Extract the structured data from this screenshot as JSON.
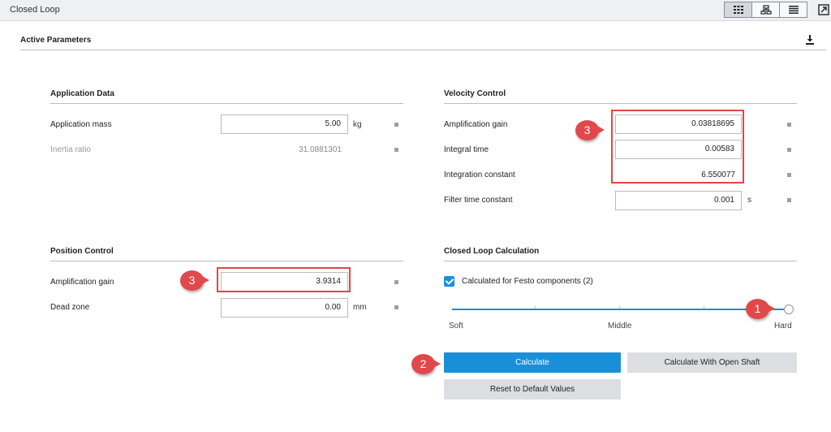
{
  "window": {
    "title": "Closed Loop"
  },
  "header": {
    "title": "Active Parameters"
  },
  "application_data": {
    "title": "Application Data",
    "mass_label": "Application mass",
    "mass_value": "5.00",
    "mass_unit": "kg",
    "inertia_label": "Inertia ratio",
    "inertia_value": "31.0881301"
  },
  "velocity_control": {
    "title": "Velocity Control",
    "amp_gain_label": "Amplification gain",
    "amp_gain_value": "0.03818695",
    "integral_time_label": "Integral time",
    "integral_time_value": "0.00583",
    "integration_constant_label": "Integration constant",
    "integration_constant_value": "6.550077",
    "filter_label": "Filter time constant",
    "filter_value": "0.001",
    "filter_unit": "s"
  },
  "position_control": {
    "title": "Position Control",
    "amp_gain_label": "Amplification gain",
    "amp_gain_value": "3.9314",
    "dead_zone_label": "Dead zone",
    "dead_zone_value": "0.00",
    "dead_zone_unit": "mm"
  },
  "closed_loop_calc": {
    "title": "Closed Loop Calculation",
    "checkbox_label": "Calculated for Festo components (2)",
    "checked": true,
    "slider": {
      "labels": [
        "Soft",
        "Middle",
        "Hard"
      ],
      "selected": "Hard",
      "level": 1.0
    },
    "calculate_label": "Calculate",
    "open_shaft_label": "Calculate With Open Shaft",
    "reset_label": "Reset to Default Values"
  },
  "annotations": {
    "badge_1": "1",
    "badge_2": "2",
    "badge_3": "3"
  },
  "colors": {
    "accent": "#1a8fd9",
    "annotation_red": "#e0464a",
    "secondary_button": "#dcdee1"
  }
}
